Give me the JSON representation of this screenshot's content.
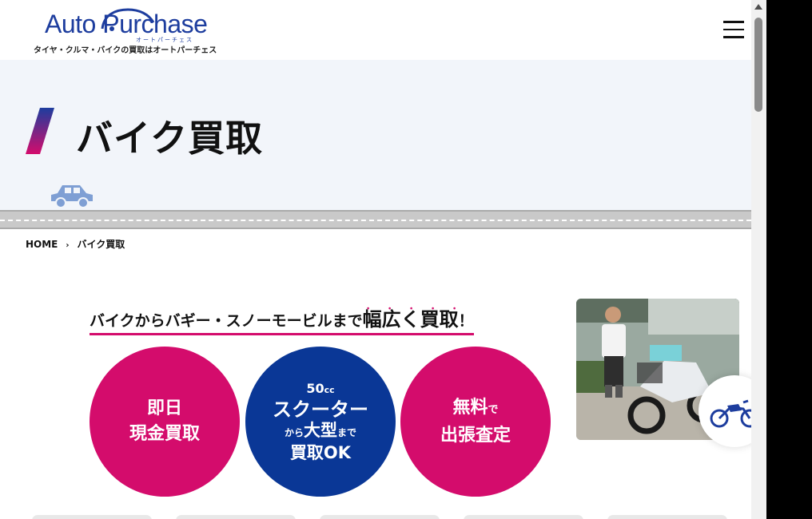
{
  "header": {
    "logo_text": "Auto Purchase",
    "logo_kana": "オートパーチェス",
    "tagline": "タイヤ・クルマ・バイクの買取はオートパーチェス",
    "menu_icon": "hamburger-icon"
  },
  "hero": {
    "title": "バイク買取"
  },
  "breadcrumb": {
    "home": "HOME",
    "current": "バイク買取"
  },
  "headline": {
    "lead": "バイクからバギー・スノーモービルまで",
    "emphasis": "幅広く買取",
    "dots": "・・・・・",
    "exclamation": "！"
  },
  "circles": [
    {
      "line1": "即日",
      "line2": "現金買取"
    },
    {
      "size": "50",
      "unit": "cc",
      "line2": "スクーター",
      "pre": "から",
      "mid": "大型",
      "post": "まで",
      "line4": "買取OK"
    },
    {
      "word": "無料",
      "suffix": "で",
      "line2": "出張査定"
    }
  ],
  "colors": {
    "accent_pink": "#d40c6c",
    "brand_blue": "#0a3796",
    "logo_blue": "#1d3d9e",
    "hero_bg": "#f2f5fa"
  }
}
